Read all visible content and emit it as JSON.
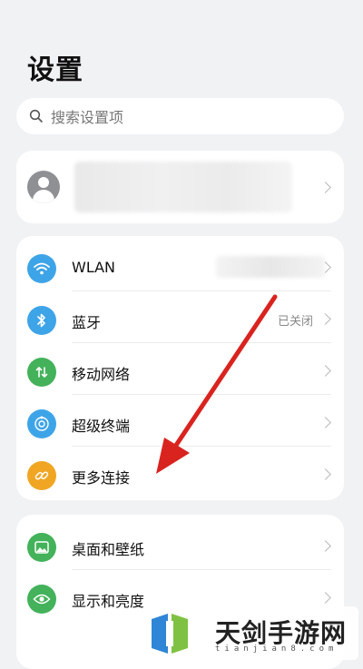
{
  "header": {
    "title": "设置"
  },
  "search": {
    "placeholder": "搜索设置项"
  },
  "connectivity": {
    "items": [
      {
        "label": "WLAN",
        "value": "",
        "icon": "wifi-icon",
        "color": "#3ea4e8"
      },
      {
        "label": "蓝牙",
        "value": "已关闭",
        "icon": "bluetooth-icon",
        "color": "#3ea4e8"
      },
      {
        "label": "移动网络",
        "value": "",
        "icon": "mobile-network-icon",
        "color": "#43b25a"
      },
      {
        "label": "超级终端",
        "value": "",
        "icon": "super-device-icon",
        "color": "#3ea4e8"
      },
      {
        "label": "更多连接",
        "value": "",
        "icon": "link-icon",
        "color": "#f0a623"
      }
    ]
  },
  "display": {
    "items": [
      {
        "label": "桌面和壁纸",
        "icon": "wallpaper-icon",
        "color": "#43b25a"
      },
      {
        "label": "显示和亮度",
        "icon": "eye-icon",
        "color": "#43b25a"
      }
    ]
  },
  "annotation": {
    "color": "#d9231f"
  },
  "watermark": {
    "text": "天剑手游网",
    "sub": "tianjian8.com"
  }
}
